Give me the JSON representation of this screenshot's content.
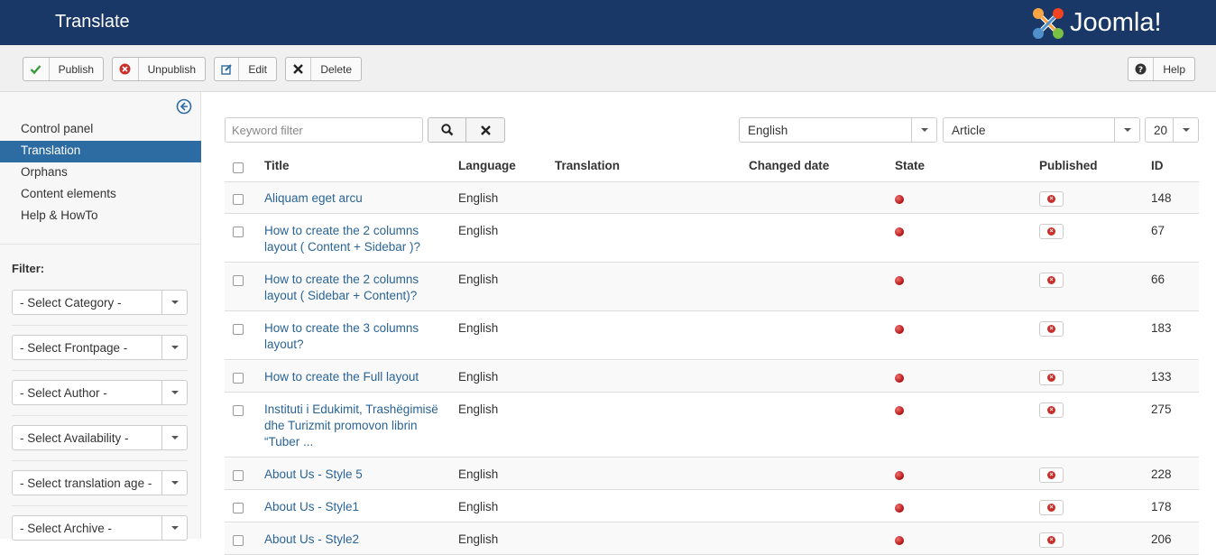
{
  "header": {
    "title": "Translate",
    "logo_text": "Joomla!"
  },
  "toolbar": {
    "publish": "Publish",
    "unpublish": "Unpublish",
    "edit": "Edit",
    "delete": "Delete",
    "help": "Help"
  },
  "sidebar": {
    "items": [
      "Control panel",
      "Translation",
      "Orphans",
      "Content elements",
      "Help & HowTo"
    ],
    "active_index": 1,
    "filter_label": "Filter:",
    "selects": [
      "- Select Category -",
      "- Select Frontpage -",
      "- Select Author -",
      "- Select Availability -",
      "- Select translation age -",
      "- Select Archive -"
    ]
  },
  "filters": {
    "keyword_placeholder": "Keyword filter",
    "language": "English",
    "content_type": "Article",
    "limit": "20"
  },
  "table": {
    "headers": {
      "title": "Title",
      "language": "Language",
      "translation": "Translation",
      "changed": "Changed date",
      "state": "State",
      "published": "Published",
      "id": "ID"
    },
    "rows": [
      {
        "title": [
          "Aliquam eget arcu"
        ],
        "language": "English",
        "id": "148"
      },
      {
        "title": [
          "How to create the 2 columns",
          "layout ( Content + Sidebar )?"
        ],
        "language": "English",
        "id": "67"
      },
      {
        "title": [
          "How to create the 2 columns",
          "layout ( Sidebar + Content)?"
        ],
        "language": "English",
        "id": "66"
      },
      {
        "title": [
          "How to create the 3 columns",
          "layout?"
        ],
        "language": "English",
        "id": "183"
      },
      {
        "title": [
          "How to create the Full layout"
        ],
        "language": "English",
        "id": "133"
      },
      {
        "title": [
          "Instituti i Edukimit, Trashëgimisë",
          "dhe Turizmit promovon librin",
          "“Tuber ..."
        ],
        "language": "English",
        "id": "275"
      },
      {
        "title": [
          "About Us - Style 5"
        ],
        "language": "English",
        "id": "228"
      },
      {
        "title": [
          "About Us - Style1"
        ],
        "language": "English",
        "id": "178"
      },
      {
        "title": [
          "About Us - Style2"
        ],
        "language": "English",
        "id": "206"
      }
    ]
  },
  "colors": {
    "header_bg": "#1a3867",
    "active_nav": "#2d6ca2",
    "link": "#2a6496",
    "state_red": "#c0392b"
  }
}
